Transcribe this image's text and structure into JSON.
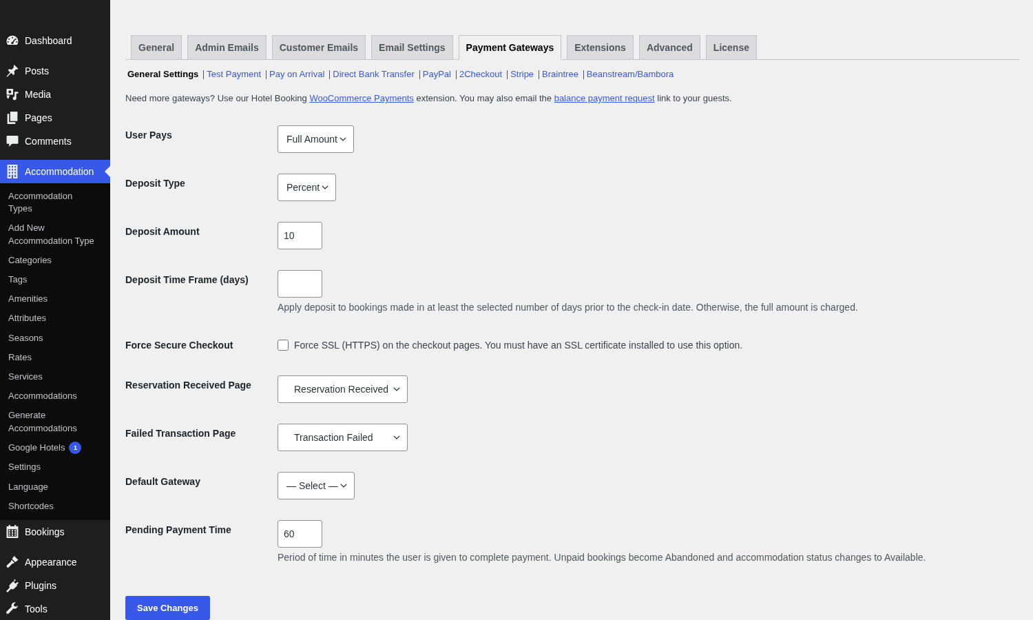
{
  "sidebar": {
    "groups": [
      {
        "items": [
          {
            "label": "Dashboard",
            "selected": false
          }
        ]
      },
      {
        "items": [
          {
            "label": "Posts",
            "selected": false
          },
          {
            "label": "Media",
            "selected": false
          },
          {
            "label": "Pages",
            "selected": false
          },
          {
            "label": "Comments",
            "selected": false
          }
        ]
      },
      {
        "items": [
          {
            "label": "Accommodation",
            "selected": true,
            "children": [
              {
                "label": "Accommodation Types",
                "selected": false
              },
              {
                "label": "Add New Accommodation Type",
                "selected": false
              },
              {
                "label": "Categories",
                "selected": false
              },
              {
                "label": "Tags",
                "selected": false
              },
              {
                "label": "Amenities",
                "selected": false
              },
              {
                "label": "Attributes",
                "selected": false
              },
              {
                "label": "Seasons",
                "selected": false
              },
              {
                "label": "Rates",
                "selected": false
              },
              {
                "label": "Services",
                "selected": false
              },
              {
                "label": "Accommodations",
                "selected": false
              },
              {
                "label": "Generate Accommodations",
                "selected": false
              },
              {
                "label": "Google Hotels",
                "badge": "1",
                "selected": false
              },
              {
                "label": "Settings",
                "selected": false
              },
              {
                "label": "Language",
                "selected": false
              },
              {
                "label": "Shortcodes",
                "selected": false
              }
            ]
          },
          {
            "label": "Bookings",
            "selected": false
          }
        ]
      },
      {
        "items": [
          {
            "label": "Appearance",
            "selected": false
          },
          {
            "label": "Plugins",
            "selected": false
          },
          {
            "label": "Tools",
            "selected": false
          }
        ]
      }
    ]
  },
  "tabs": [
    {
      "label": "General",
      "selected": false
    },
    {
      "label": "Admin Emails",
      "selected": false
    },
    {
      "label": "Customer Emails",
      "selected": false
    },
    {
      "label": "Email Settings",
      "selected": false
    },
    {
      "label": "Payment Gateways",
      "selected": true
    },
    {
      "label": "Extensions",
      "selected": false
    },
    {
      "label": "Advanced",
      "selected": false
    },
    {
      "label": "License",
      "selected": false
    }
  ],
  "subnav": [
    {
      "label": "General Settings",
      "selected": true
    },
    {
      "label": "Test Payment",
      "selected": false
    },
    {
      "label": "Pay on Arrival",
      "selected": false
    },
    {
      "label": "Direct Bank Transfer",
      "selected": false
    },
    {
      "label": "PayPal",
      "selected": false
    },
    {
      "label": "2Checkout",
      "selected": false
    },
    {
      "label": "Stripe",
      "selected": false
    },
    {
      "label": "Braintree",
      "selected": false
    },
    {
      "label": "Beanstream/Bambora",
      "selected": false
    }
  ],
  "notice": [
    {
      "kind": "text",
      "text": "Need more gateways? Use our Hotel Booking "
    },
    {
      "kind": "link",
      "text": "WooCommerce Payments"
    },
    {
      "kind": "text",
      "text": " extension. You may also email the "
    },
    {
      "kind": "link",
      "text": "balance payment request"
    },
    {
      "kind": "text",
      "text": " link to your guests."
    }
  ],
  "settings": [
    {
      "label": "User Pays",
      "kind": "select",
      "value": "Full Amount"
    },
    {
      "label": "Deposit Type",
      "kind": "select",
      "value": "Percent"
    },
    {
      "label": "Deposit Amount",
      "kind": "input",
      "value": "10"
    },
    {
      "label": "Deposit Time Frame (days)",
      "kind": "input",
      "description": "Apply deposit to bookings made in at least the selected number of days prior to the check-in date. Otherwise, the full amount is charged."
    },
    {
      "label": "Force Secure Checkout",
      "kind": "checkbox",
      "checked": false,
      "text": "Force SSL (HTTPS) on the checkout pages. You must have an SSL certificate installed to use this option."
    },
    {
      "label": "Reservation Received Page",
      "kind": "page_select",
      "value": "Reservation Received"
    },
    {
      "label": "Failed Transaction Page",
      "kind": "page_select",
      "value": "Transaction Failed"
    },
    {
      "label": "Default Gateway",
      "kind": "select",
      "value": "— Select —"
    },
    {
      "label": "Pending Payment Time",
      "kind": "input",
      "value": "60",
      "description": "Period of time in minutes the user is given to complete payment. Unpaid bookings become Abandoned and accommodation status changes to Available."
    }
  ],
  "save_button": "Save Changes"
}
